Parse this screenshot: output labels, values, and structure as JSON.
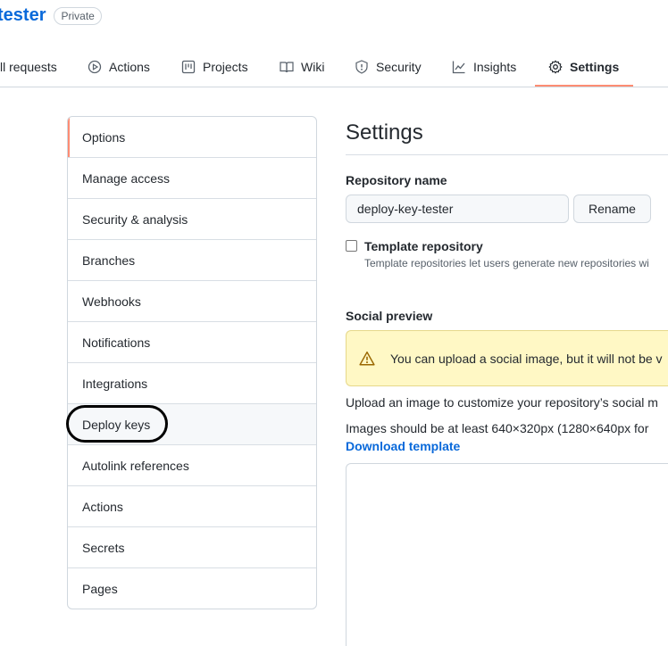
{
  "header": {
    "repo_name": "tester",
    "visibility_badge": "Private"
  },
  "tabs": [
    {
      "label": "ll requests",
      "icon": "pull-request-icon"
    },
    {
      "label": "Actions",
      "icon": "play-icon"
    },
    {
      "label": "Projects",
      "icon": "project-icon"
    },
    {
      "label": "Wiki",
      "icon": "book-icon"
    },
    {
      "label": "Security",
      "icon": "shield-icon"
    },
    {
      "label": "Insights",
      "icon": "graph-icon"
    },
    {
      "label": "Settings",
      "icon": "gear-icon",
      "selected": true
    }
  ],
  "sidebar": {
    "items": [
      {
        "label": "Options",
        "selected": true
      },
      {
        "label": "Manage access"
      },
      {
        "label": "Security & analysis"
      },
      {
        "label": "Branches"
      },
      {
        "label": "Webhooks"
      },
      {
        "label": "Notifications"
      },
      {
        "label": "Integrations"
      },
      {
        "label": "Deploy keys",
        "highlighted": true
      },
      {
        "label": "Autolink references"
      },
      {
        "label": "Actions"
      },
      {
        "label": "Secrets"
      },
      {
        "label": "Pages"
      }
    ]
  },
  "main": {
    "title": "Settings",
    "repo_name_label": "Repository name",
    "repo_name_value": "deploy-key-tester",
    "rename_button": "Rename",
    "template_label": "Template repository",
    "template_note": "Template repositories let users generate new repositories wi",
    "social_preview_label": "Social preview",
    "flash_text": "You can upload a social image, but it will not be v",
    "upload_text": "Upload an image to customize your repository’s social m",
    "size_text": "Images should be at least 640×320px (1280×640px for",
    "download_link": "Download template"
  },
  "colors": {
    "accent_link": "#0969da",
    "tab_underline": "#fd8c73",
    "flash_bg": "#fff8c5"
  }
}
